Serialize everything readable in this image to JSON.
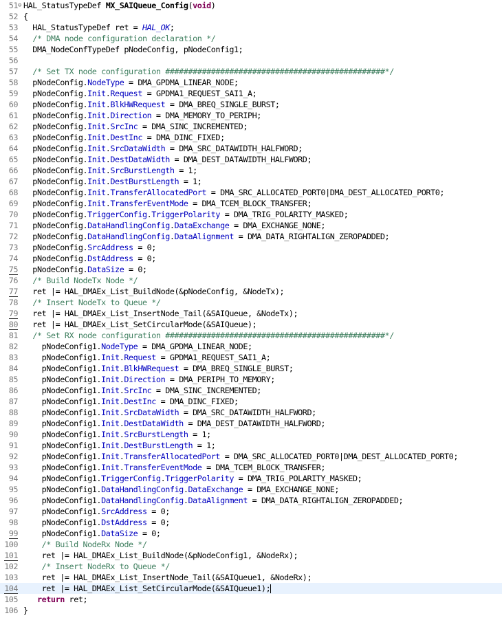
{
  "lines": [
    {
      "n": "51",
      "fold": "⊖",
      "code": [
        [
          "",
          "HAL_StatusTypeDef "
        ],
        [
          "fn",
          "MX_SAIQueue_Config"
        ],
        [
          "",
          "("
        ],
        [
          "kw",
          "void"
        ],
        [
          "",
          ")"
        ]
      ]
    },
    {
      "n": "52",
      "code": [
        [
          "",
          "{"
        ]
      ]
    },
    {
      "n": "53",
      "code": [
        [
          "",
          "  HAL_StatusTypeDef ret = "
        ],
        [
          "const",
          "HAL_OK"
        ],
        [
          "",
          ";"
        ]
      ]
    },
    {
      "n": "54",
      "code": [
        [
          "",
          "  "
        ],
        [
          "cm",
          "/* DMA node configuration declaration */"
        ]
      ]
    },
    {
      "n": "55",
      "code": [
        [
          "",
          "  DMA_NodeConfTypeDef pNodeConfig, pNodeConfig1;"
        ]
      ]
    },
    {
      "n": "56",
      "code": []
    },
    {
      "n": "57",
      "code": [
        [
          "",
          "  "
        ],
        [
          "cm",
          "/* Set TX node configuration ################################################*/"
        ]
      ]
    },
    {
      "n": "58",
      "code": [
        [
          "",
          "  pNodeConfig."
        ],
        [
          "fld",
          "NodeType"
        ],
        [
          "",
          " = DMA_GPDMA_LINEAR_NODE;"
        ]
      ]
    },
    {
      "n": "59",
      "code": [
        [
          "",
          "  pNodeConfig."
        ],
        [
          "fld",
          "Init"
        ],
        [
          "",
          "."
        ],
        [
          "fld",
          "Request"
        ],
        [
          "",
          " = GPDMA1_REQUEST_SAI1_A;"
        ]
      ]
    },
    {
      "n": "60",
      "code": [
        [
          "",
          "  pNodeConfig."
        ],
        [
          "fld",
          "Init"
        ],
        [
          "",
          "."
        ],
        [
          "fld",
          "BlkHWRequest"
        ],
        [
          "",
          " = DMA_BREQ_SINGLE_BURST;"
        ]
      ]
    },
    {
      "n": "61",
      "code": [
        [
          "",
          "  pNodeConfig."
        ],
        [
          "fld",
          "Init"
        ],
        [
          "",
          "."
        ],
        [
          "fld",
          "Direction"
        ],
        [
          "",
          " = DMA_MEMORY_TO_PERIPH;"
        ]
      ]
    },
    {
      "n": "62",
      "code": [
        [
          "",
          "  pNodeConfig."
        ],
        [
          "fld",
          "Init"
        ],
        [
          "",
          "."
        ],
        [
          "fld",
          "SrcInc"
        ],
        [
          "",
          " = DMA_SINC_INCREMENTED;"
        ]
      ]
    },
    {
      "n": "63",
      "code": [
        [
          "",
          "  pNodeConfig."
        ],
        [
          "fld",
          "Init"
        ],
        [
          "",
          "."
        ],
        [
          "fld",
          "DestInc"
        ],
        [
          "",
          " = DMA_DINC_FIXED;"
        ]
      ]
    },
    {
      "n": "64",
      "code": [
        [
          "",
          "  pNodeConfig."
        ],
        [
          "fld",
          "Init"
        ],
        [
          "",
          "."
        ],
        [
          "fld",
          "SrcDataWidth"
        ],
        [
          "",
          " = DMA_SRC_DATAWIDTH_HALFWORD;"
        ]
      ]
    },
    {
      "n": "65",
      "code": [
        [
          "",
          "  pNodeConfig."
        ],
        [
          "fld",
          "Init"
        ],
        [
          "",
          "."
        ],
        [
          "fld",
          "DestDataWidth"
        ],
        [
          "",
          " = DMA_DEST_DATAWIDTH_HALFWORD;"
        ]
      ]
    },
    {
      "n": "66",
      "code": [
        [
          "",
          "  pNodeConfig."
        ],
        [
          "fld",
          "Init"
        ],
        [
          "",
          "."
        ],
        [
          "fld",
          "SrcBurstLength"
        ],
        [
          "",
          " = 1;"
        ]
      ]
    },
    {
      "n": "67",
      "code": [
        [
          "",
          "  pNodeConfig."
        ],
        [
          "fld",
          "Init"
        ],
        [
          "",
          "."
        ],
        [
          "fld",
          "DestBurstLength"
        ],
        [
          "",
          " = 1;"
        ]
      ]
    },
    {
      "n": "68",
      "code": [
        [
          "",
          "  pNodeConfig."
        ],
        [
          "fld",
          "Init"
        ],
        [
          "",
          "."
        ],
        [
          "fld",
          "TransferAllocatedPort"
        ],
        [
          "",
          " = DMA_SRC_ALLOCATED_PORT0|DMA_DEST_ALLOCATED_PORT0;"
        ]
      ]
    },
    {
      "n": "69",
      "code": [
        [
          "",
          "  pNodeConfig."
        ],
        [
          "fld",
          "Init"
        ],
        [
          "",
          "."
        ],
        [
          "fld",
          "TransferEventMode"
        ],
        [
          "",
          " = DMA_TCEM_BLOCK_TRANSFER;"
        ]
      ]
    },
    {
      "n": "70",
      "code": [
        [
          "",
          "  pNodeConfig."
        ],
        [
          "fld",
          "TriggerConfig"
        ],
        [
          "",
          "."
        ],
        [
          "fld",
          "TriggerPolarity"
        ],
        [
          "",
          " = DMA_TRIG_POLARITY_MASKED;"
        ]
      ]
    },
    {
      "n": "71",
      "code": [
        [
          "",
          "  pNodeConfig."
        ],
        [
          "fld",
          "DataHandlingConfig"
        ],
        [
          "",
          "."
        ],
        [
          "fld",
          "DataExchange"
        ],
        [
          "",
          " = DMA_EXCHANGE_NONE;"
        ]
      ]
    },
    {
      "n": "72",
      "code": [
        [
          "",
          "  pNodeConfig."
        ],
        [
          "fld",
          "DataHandlingConfig"
        ],
        [
          "",
          "."
        ],
        [
          "fld",
          "DataAlignment"
        ],
        [
          "",
          " = DMA_DATA_RIGHTALIGN_ZEROPADDED;"
        ]
      ]
    },
    {
      "n": "73",
      "code": [
        [
          "",
          "  pNodeConfig."
        ],
        [
          "fld",
          "SrcAddress"
        ],
        [
          "",
          " = 0;"
        ]
      ]
    },
    {
      "n": "74",
      "code": [
        [
          "",
          "  pNodeConfig."
        ],
        [
          "fld",
          "DstAddress"
        ],
        [
          "",
          " = 0;"
        ]
      ]
    },
    {
      "n": "75",
      "mark": true,
      "code": [
        [
          "",
          "  pNodeConfig."
        ],
        [
          "fld",
          "DataSize"
        ],
        [
          "",
          " = 0;"
        ]
      ]
    },
    {
      "n": "76",
      "code": [
        [
          "",
          "  "
        ],
        [
          "cm",
          "/* Build NodeTx Node */"
        ]
      ]
    },
    {
      "n": "77",
      "mark": true,
      "code": [
        [
          "",
          "  ret |= HAL_DMAEx_List_BuildNode(&pNodeConfig, &NodeTx);"
        ]
      ]
    },
    {
      "n": "78",
      "code": [
        [
          "",
          "  "
        ],
        [
          "cm",
          "/* Insert NodeTx to Queue */"
        ]
      ]
    },
    {
      "n": "79",
      "mark": true,
      "code": [
        [
          "",
          "  ret |= HAL_DMAEx_List_InsertNode_Tail(&SAIQueue, &NodeTx);"
        ]
      ]
    },
    {
      "n": "80",
      "mark": true,
      "code": [
        [
          "",
          "  ret |= HAL_DMAEx_List_SetCircularMode(&SAIQueue);"
        ]
      ]
    },
    {
      "n": "81",
      "code": [
        [
          "",
          "  "
        ],
        [
          "cm",
          "/* Set RX node configuration ################################################*/"
        ]
      ]
    },
    {
      "n": "82",
      "code": [
        [
          "",
          "    pNodeConfig1."
        ],
        [
          "fld",
          "NodeType"
        ],
        [
          "",
          " = DMA_GPDMA_LINEAR_NODE;"
        ]
      ]
    },
    {
      "n": "83",
      "code": [
        [
          "",
          "    pNodeConfig1."
        ],
        [
          "fld",
          "Init"
        ],
        [
          "",
          "."
        ],
        [
          "fld",
          "Request"
        ],
        [
          "",
          " = GPDMA1_REQUEST_SAI1_A;"
        ]
      ]
    },
    {
      "n": "84",
      "code": [
        [
          "",
          "    pNodeConfig1."
        ],
        [
          "fld",
          "Init"
        ],
        [
          "",
          "."
        ],
        [
          "fld",
          "BlkHWRequest"
        ],
        [
          "",
          " = DMA_BREQ_SINGLE_BURST;"
        ]
      ]
    },
    {
      "n": "85",
      "code": [
        [
          "",
          "    pNodeConfig1."
        ],
        [
          "fld",
          "Init"
        ],
        [
          "",
          "."
        ],
        [
          "fld",
          "Direction"
        ],
        [
          "",
          " = DMA_PERIPH_TO_MEMORY;"
        ]
      ]
    },
    {
      "n": "86",
      "code": [
        [
          "",
          "    pNodeConfig1."
        ],
        [
          "fld",
          "Init"
        ],
        [
          "",
          "."
        ],
        [
          "fld",
          "SrcInc"
        ],
        [
          "",
          " = DMA_SINC_INCREMENTED;"
        ]
      ]
    },
    {
      "n": "87",
      "code": [
        [
          "",
          "    pNodeConfig1."
        ],
        [
          "fld",
          "Init"
        ],
        [
          "",
          "."
        ],
        [
          "fld",
          "DestInc"
        ],
        [
          "",
          " = DMA_DINC_FIXED;"
        ]
      ]
    },
    {
      "n": "88",
      "code": [
        [
          "",
          "    pNodeConfig1."
        ],
        [
          "fld",
          "Init"
        ],
        [
          "",
          "."
        ],
        [
          "fld",
          "SrcDataWidth"
        ],
        [
          "",
          " = DMA_SRC_DATAWIDTH_HALFWORD;"
        ]
      ]
    },
    {
      "n": "89",
      "code": [
        [
          "",
          "    pNodeConfig1."
        ],
        [
          "fld",
          "Init"
        ],
        [
          "",
          "."
        ],
        [
          "fld",
          "DestDataWidth"
        ],
        [
          "",
          " = DMA_DEST_DATAWIDTH_HALFWORD;"
        ]
      ]
    },
    {
      "n": "90",
      "code": [
        [
          "",
          "    pNodeConfig1."
        ],
        [
          "fld",
          "Init"
        ],
        [
          "",
          "."
        ],
        [
          "fld",
          "SrcBurstLength"
        ],
        [
          "",
          " = 1;"
        ]
      ]
    },
    {
      "n": "91",
      "code": [
        [
          "",
          "    pNodeConfig1."
        ],
        [
          "fld",
          "Init"
        ],
        [
          "",
          "."
        ],
        [
          "fld",
          "DestBurstLength"
        ],
        [
          "",
          " = 1;"
        ]
      ]
    },
    {
      "n": "92",
      "code": [
        [
          "",
          "    pNodeConfig1."
        ],
        [
          "fld",
          "Init"
        ],
        [
          "",
          "."
        ],
        [
          "fld",
          "TransferAllocatedPort"
        ],
        [
          "",
          " = DMA_SRC_ALLOCATED_PORT0|DMA_DEST_ALLOCATED_PORT0;"
        ]
      ]
    },
    {
      "n": "93",
      "code": [
        [
          "",
          "    pNodeConfig1."
        ],
        [
          "fld",
          "Init"
        ],
        [
          "",
          "."
        ],
        [
          "fld",
          "TransferEventMode"
        ],
        [
          "",
          " = DMA_TCEM_BLOCK_TRANSFER;"
        ]
      ]
    },
    {
      "n": "94",
      "code": [
        [
          "",
          "    pNodeConfig1."
        ],
        [
          "fld",
          "TriggerConfig"
        ],
        [
          "",
          "."
        ],
        [
          "fld",
          "TriggerPolarity"
        ],
        [
          "",
          " = DMA_TRIG_POLARITY_MASKED;"
        ]
      ]
    },
    {
      "n": "95",
      "code": [
        [
          "",
          "    pNodeConfig1."
        ],
        [
          "fld",
          "DataHandlingConfig"
        ],
        [
          "",
          "."
        ],
        [
          "fld",
          "DataExchange"
        ],
        [
          "",
          " = DMA_EXCHANGE_NONE;"
        ]
      ]
    },
    {
      "n": "96",
      "code": [
        [
          "",
          "    pNodeConfig1."
        ],
        [
          "fld",
          "DataHandlingConfig"
        ],
        [
          "",
          "."
        ],
        [
          "fld",
          "DataAlignment"
        ],
        [
          "",
          " = DMA_DATA_RIGHTALIGN_ZEROPADDED;"
        ]
      ]
    },
    {
      "n": "97",
      "code": [
        [
          "",
          "    pNodeConfig1."
        ],
        [
          "fld",
          "SrcAddress"
        ],
        [
          "",
          " = 0;"
        ]
      ]
    },
    {
      "n": "98",
      "code": [
        [
          "",
          "    pNodeConfig1."
        ],
        [
          "fld",
          "DstAddress"
        ],
        [
          "",
          " = 0;"
        ]
      ]
    },
    {
      "n": "99",
      "mark": true,
      "code": [
        [
          "",
          "    pNodeConfig1."
        ],
        [
          "fld",
          "DataSize"
        ],
        [
          "",
          " = 0;"
        ]
      ]
    },
    {
      "n": "100",
      "code": [
        [
          "",
          "    "
        ],
        [
          "cm",
          "/* Build NodeRx Node */"
        ]
      ]
    },
    {
      "n": "101",
      "mark": true,
      "code": [
        [
          "",
          "    ret |= HAL_DMAEx_List_BuildNode(&pNodeConfig1, &NodeRx);"
        ]
      ]
    },
    {
      "n": "102",
      "code": [
        [
          "",
          "    "
        ],
        [
          "cm",
          "/* Insert NodeRx to Queue */"
        ]
      ]
    },
    {
      "n": "103",
      "code": [
        [
          "",
          "    ret |= HAL_DMAEx_List_InsertNode_Tail(&SAIQueue1, &NodeRx);"
        ]
      ]
    },
    {
      "n": "104",
      "mark": true,
      "current": true,
      "caret": true,
      "code": [
        [
          "",
          "    ret |= HAL_DMAEx_List_SetCircularMode(&SAIQueue1);"
        ]
      ]
    },
    {
      "n": "105",
      "code": [
        [
          "",
          "   "
        ],
        [
          "kw",
          "return"
        ],
        [
          "",
          " ret;"
        ]
      ]
    },
    {
      "n": "106",
      "code": [
        [
          "",
          "}"
        ]
      ]
    }
  ]
}
